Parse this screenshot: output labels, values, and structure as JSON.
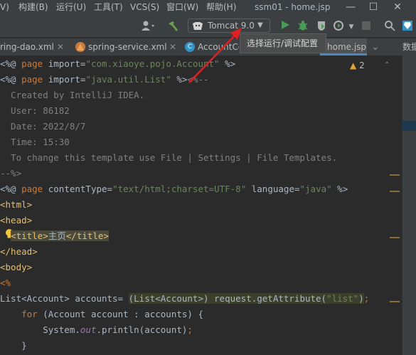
{
  "menubar": {
    "items": [
      "V)",
      "构建(B)",
      "运行(U)",
      "工具(T)",
      "VCS(S)",
      "窗口(W)",
      "帮助(H)"
    ],
    "window_title": "ssm01 - home.jsp",
    "minimize": "—",
    "restore": "☐",
    "close": "✕"
  },
  "toolbar": {
    "run_config": "Tomcat 9.0",
    "caret": "▼"
  },
  "tooltip": {
    "text": "选择运行/调试配置"
  },
  "tabs": {
    "items": [
      "ring-dao.xml",
      "spring-service.xml",
      "AccountCo",
      "home.jsp"
    ],
    "close": "✕",
    "more": "⌄",
    "right_panel": "数据"
  },
  "editor": {
    "warning_count": "2",
    "lines": {
      "l1": {
        "a": "<%@ ",
        "b": "page ",
        "c": "import",
        "d": "=",
        "e": "\"com.xiaoye.pojo.Account\"",
        "f": " %>"
      },
      "l2": {
        "a": "<%@ ",
        "b": "page ",
        "c": "import",
        "d": "=",
        "e": "\"java.util.List\"",
        "f": " %>",
        "g": "<%--"
      },
      "l3": "  Created by IntelliJ IDEA.",
      "l4": "  User: 86182",
      "l5": "  Date: 2022/8/7",
      "l6": "  Time: 15:30",
      "l7": "  To change this template use File | Settings | File Templates.",
      "l8": "--%>",
      "l9": {
        "a": "<%@ ",
        "b": "page ",
        "c": "contentType",
        "d": "=",
        "e": "\"text/html;charset=UTF-8\"",
        "f": " language",
        "g": "=",
        "h": "\"java\"",
        "i": " %>"
      },
      "l10": "<html>",
      "l11": "<head>",
      "l12": {
        "a": "<title>",
        "b": "主页",
        "c": "</title>"
      },
      "l13": "</head>",
      "l14": "<body>",
      "l15": "<%",
      "l16": {
        "a": "List<Account> accounts= ",
        "b": "(List<Account>) request.getAttribute(",
        "c": "\"list\"",
        "d": ")",
        "e": ";"
      },
      "l17": {
        "a": "    ",
        "b": "for",
        "c": " (Account account : accounts) {"
      },
      "l18": {
        "a": "        System.",
        "b": "out",
        "c": ".println(account)",
        "d": ";"
      },
      "l19": "    }"
    }
  }
}
